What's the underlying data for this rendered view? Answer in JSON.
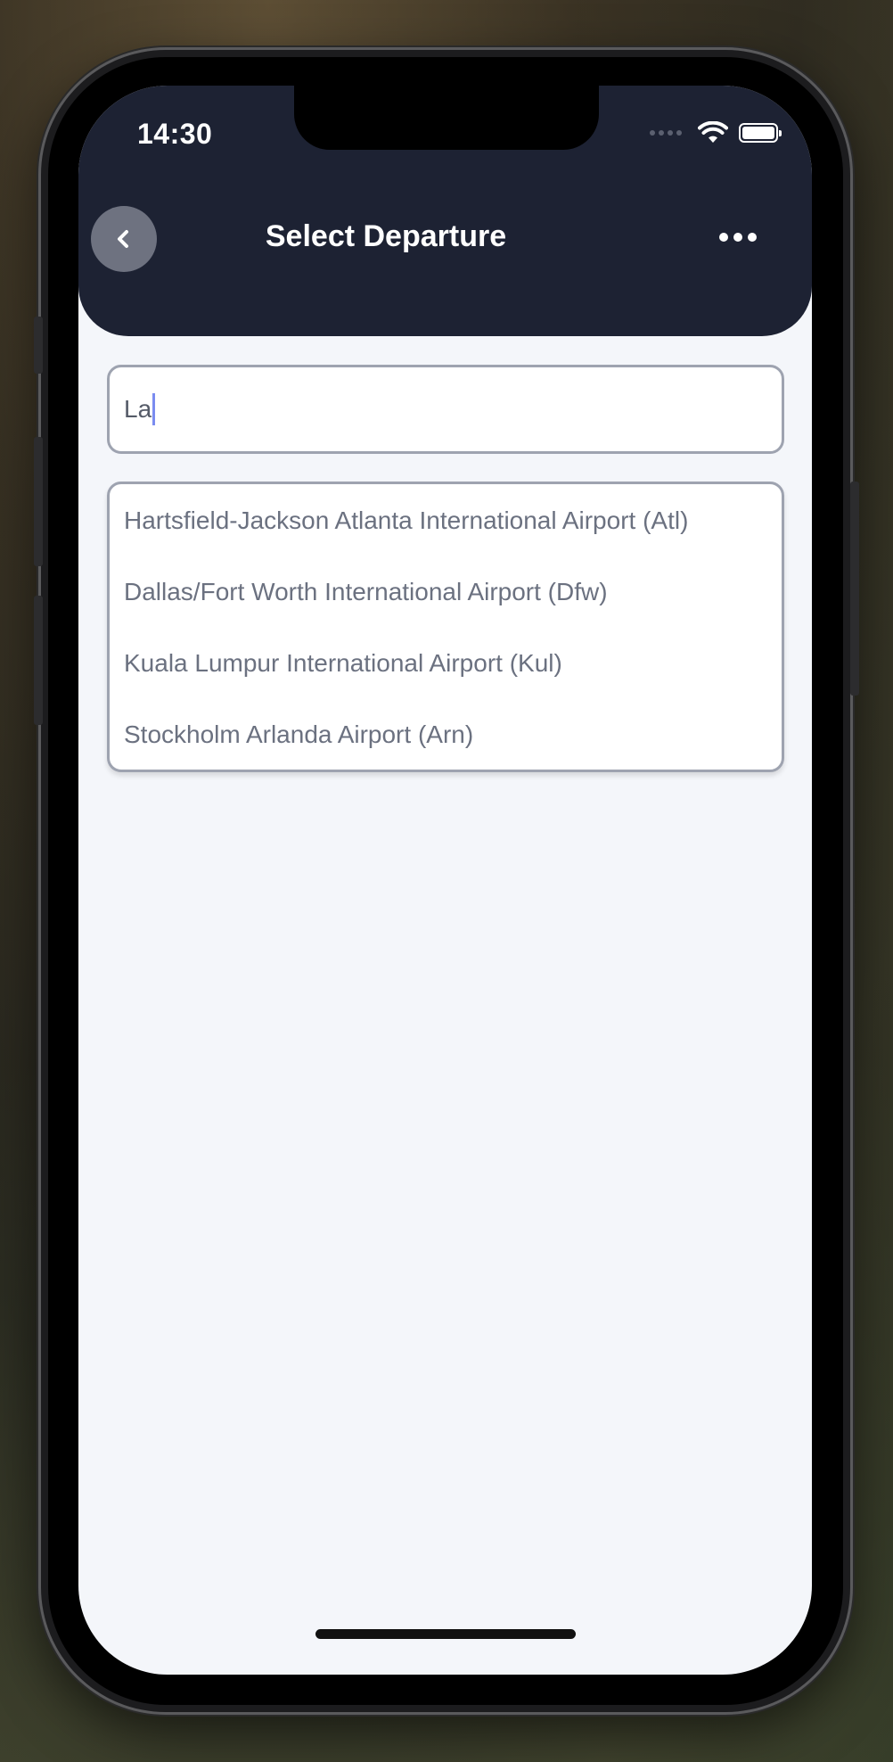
{
  "status_bar": {
    "time": "14:30"
  },
  "header": {
    "title": "Select Departure",
    "back_icon": "chevron-left-icon",
    "more_icon": "more-horizontal-icon"
  },
  "search": {
    "value": "La"
  },
  "results": [
    {
      "label": "Hartsfield-Jackson Atlanta International Airport (Atl)"
    },
    {
      "label": "Dallas/Fort Worth International Airport (Dfw)"
    },
    {
      "label": "Kuala Lumpur International Airport (Kul)"
    },
    {
      "label": "Stockholm Arlanda Airport (Arn)"
    }
  ],
  "colors": {
    "header_bg": "#1d2233",
    "screen_bg": "#f4f6fa",
    "text_muted": "#6b7180",
    "caret": "#7b8cf0"
  }
}
